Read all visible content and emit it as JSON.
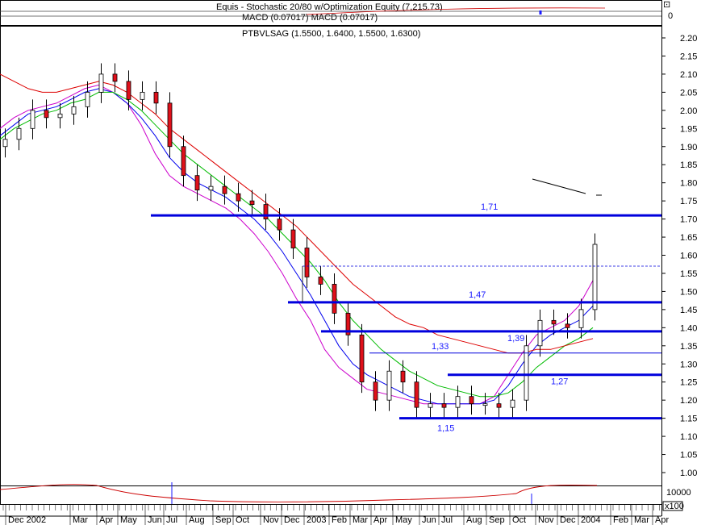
{
  "header": {
    "indicator_title": "Equis - Stochastic 20/80 w/Optimization Equity (7,215.73)",
    "macd_title": "MACD (0.07017) MACD (0.07017)",
    "zero_label": "0",
    "price_title": "PTBVLSAG (1.5500, 1.6400, 1.5500, 1.6300)",
    "bottom_label": "10000",
    "unit_label": "x100"
  },
  "colors": {
    "up_candle": "#ffffff",
    "down_candle": "#e0101a",
    "support_line": "#0000dd",
    "ma_fast": "#cc00cc",
    "ma_mid": "#0000ee",
    "ma_slow": "#00bb00",
    "ma_long": "#dd0000"
  },
  "chart_data": {
    "type": "line",
    "title": "PTBVLSAG (1.5500, 1.6400, 1.5500, 1.6300)",
    "ylim": [
      1.0,
      2.25
    ],
    "y_ticks": [
      "2.20",
      "2.15",
      "2.10",
      "2.05",
      "2.00",
      "1.95",
      "1.90",
      "1.85",
      "1.80",
      "1.75",
      "1.70",
      "1.65",
      "1.60",
      "1.55",
      "1.50",
      "1.45",
      "1.40",
      "1.35",
      "1.30",
      "1.25",
      "1.20",
      "1.15",
      "1.10",
      "1.05",
      "1.00"
    ],
    "x_labels": [
      "Dec 2002",
      "Mar",
      "Apr",
      "May",
      "Jun",
      "Jul",
      "Aug",
      "Sep",
      "Oct",
      "Nov",
      "Dec",
      "2003",
      "Feb",
      "Mar",
      "Apr",
      "May",
      "Jun",
      "Jul",
      "Aug",
      "Sep",
      "Oct",
      "Nov",
      "Dec",
      "2004",
      "Feb",
      "Mar",
      "Apr"
    ],
    "levels": [
      {
        "label": "1,71",
        "value": 1.71,
        "from_month": 5.5,
        "to_month": 28
      },
      {
        "label": "1,47",
        "value": 1.47,
        "from_month": 11.5,
        "to_month": 28
      },
      {
        "label": "1,39",
        "value": 1.39,
        "from_month": 12.5,
        "to_month": 28
      },
      {
        "label": "1,33",
        "value": 1.33,
        "from_month": 15.0,
        "to_month": 28
      },
      {
        "label": "1,27",
        "value": 1.27,
        "from_month": 18.0,
        "to_month": 28
      },
      {
        "label": "1,15",
        "value": 1.15,
        "from_month": 16.0,
        "to_month": 28
      }
    ],
    "dashed_level": 1.57,
    "price_close": [
      1.92,
      1.95,
      2.0,
      1.98,
      1.99,
      2.01,
      2.05,
      2.1,
      2.08,
      2.03,
      2.05,
      2.02,
      1.9,
      1.82,
      1.78,
      1.79,
      1.77,
      1.75,
      1.74,
      1.7,
      1.67,
      1.62,
      1.54,
      1.52,
      1.44,
      1.38,
      1.25,
      1.2,
      1.28,
      1.25,
      1.18,
      1.19,
      1.18,
      1.21,
      1.19,
      1.19,
      1.18,
      1.2,
      1.35,
      1.42,
      1.41,
      1.4,
      1.45,
      1.63
    ],
    "series": [
      {
        "name": "",
        "values": [
          1.95,
          1.98,
          2.0,
          2.01,
          2.02,
          2.04,
          2.06,
          2.07,
          2.05,
          2.02,
          1.96,
          1.88,
          1.82,
          1.79,
          1.77,
          1.75,
          1.73,
          1.7,
          1.66,
          1.61,
          1.55,
          1.48,
          1.42,
          1.34,
          1.29,
          1.26,
          1.23,
          1.22,
          1.21,
          1.2,
          1.19,
          1.19,
          1.19,
          1.19,
          1.19,
          1.21,
          1.27,
          1.33,
          1.38,
          1.4,
          1.42,
          1.46,
          1.53
        ]
      },
      {
        "name": "",
        "values": [
          1.93,
          1.96,
          1.99,
          2.0,
          2.01,
          2.03,
          2.05,
          2.06,
          2.05,
          2.02,
          1.98,
          1.93,
          1.87,
          1.83,
          1.8,
          1.78,
          1.76,
          1.73,
          1.7,
          1.66,
          1.61,
          1.55,
          1.49,
          1.42,
          1.35,
          1.3,
          1.27,
          1.25,
          1.23,
          1.21,
          1.2,
          1.19,
          1.19,
          1.19,
          1.19,
          1.2,
          1.24,
          1.3,
          1.35,
          1.38,
          1.4,
          1.42,
          1.46
        ]
      },
      {
        "name": "",
        "values": [
          1.92,
          1.95,
          1.97,
          1.99,
          2.0,
          2.02,
          2.03,
          2.05,
          2.05,
          2.03,
          2.0,
          1.96,
          1.92,
          1.88,
          1.85,
          1.82,
          1.79,
          1.76,
          1.73,
          1.7,
          1.66,
          1.62,
          1.58,
          1.53,
          1.47,
          1.42,
          1.38,
          1.34,
          1.31,
          1.28,
          1.26,
          1.24,
          1.23,
          1.22,
          1.21,
          1.21,
          1.22,
          1.25,
          1.29,
          1.32,
          1.35,
          1.37,
          1.4
        ]
      },
      {
        "name": "",
        "values": [
          2.1,
          2.08,
          2.06,
          2.05,
          2.05,
          2.06,
          2.07,
          2.08,
          2.07,
          2.05,
          2.02,
          1.99,
          1.95,
          1.92,
          1.89,
          1.86,
          1.83,
          1.8,
          1.77,
          1.74,
          1.71,
          1.68,
          1.64,
          1.6,
          1.56,
          1.52,
          1.49,
          1.46,
          1.43,
          1.41,
          1.4,
          1.38,
          1.37,
          1.36,
          1.35,
          1.34,
          1.33,
          1.33,
          1.34,
          1.34,
          1.35,
          1.36,
          1.37
        ]
      }
    ],
    "grid": false,
    "legend": "none"
  }
}
